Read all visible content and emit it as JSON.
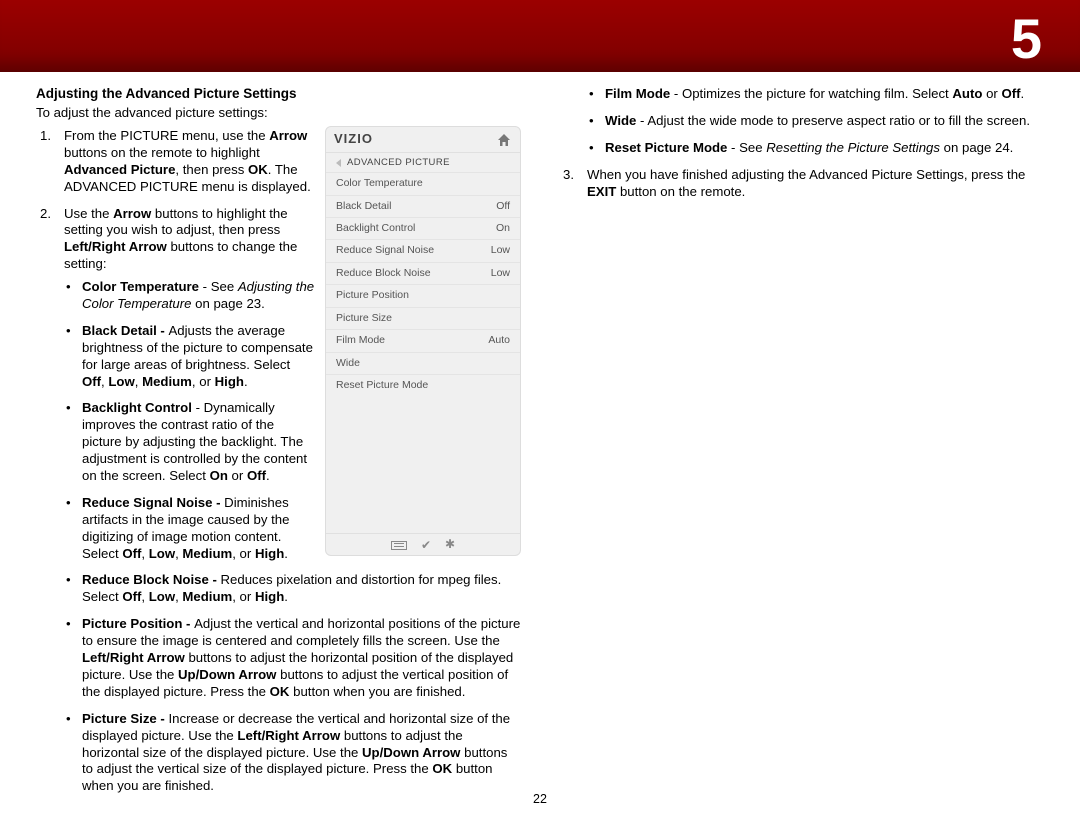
{
  "chapter": "5",
  "page_number": "22",
  "heading": "Adjusting the Advanced Picture Settings",
  "intro": "To adjust the advanced picture settings:",
  "step1": {
    "a": "From the PICTURE menu, use the ",
    "b": "Arrow",
    "c": " buttons on the remote to highlight ",
    "d": "Advanced Picture",
    "e": ", then press ",
    "f": "OK",
    "g": ". The ADVANCED PICTURE menu is displayed."
  },
  "step2": {
    "a": "Use the ",
    "b": "Arrow",
    "c": " buttons to highlight the setting you wish to adjust, then press ",
    "d": "Left/Right Arrow",
    "e": " buttons to change the setting:"
  },
  "bullets": {
    "ct": {
      "t": "Color Temperature",
      "a": " - See ",
      "it": "Adjusting the Color Temperature",
      "b": " on page 23."
    },
    "bd": {
      "t": "Black Detail - ",
      "a": "Adjusts the average brightness of the picture to compensate for large areas of brightness. Select ",
      "o1": "Off",
      "c1": ", ",
      "o2": "Low",
      "c2": ", ",
      "o3": "Medium",
      "c3": ", or ",
      "o4": "High",
      "p": "."
    },
    "bc": {
      "t": "Backlight Control",
      "a": " - Dynamically improves the contrast ratio of the picture by adjusting the backlight. The adjustment is controlled by the content on the screen. Select ",
      "o1": "On",
      "c1": " or ",
      "o2": "Off",
      "p": "."
    },
    "rsn": {
      "t": "Reduce Signal Noise - ",
      "a": "Diminishes artifacts in the image caused by the digitizing of image motion content. Select ",
      "o1": "Off",
      "c1": ", ",
      "o2": "Low",
      "c2": ", ",
      "o3": "Medium",
      "c3": ", or ",
      "o4": "High",
      "p": "."
    },
    "rbn": {
      "t": "Reduce Block Noise - ",
      "a": "Reduces pixelation and distortion for mpeg files. Select ",
      "o1": "Off",
      "c1": ", ",
      "o2": "Low",
      "c2": ", ",
      "o3": "Medium",
      "c3": ", or ",
      "o4": "High",
      "p": "."
    },
    "pp": {
      "t": "Picture Position - ",
      "a": "Adjust the vertical and horizontal positions of the picture to ensure the image is centered and completely fills the screen. Use the ",
      "b": "Left/Right Arrow",
      "c": " buttons to adjust the horizontal position of the displayed picture. Use the ",
      "d": "Up/Down Arrow",
      "e": " buttons to adjust the vertical position of the displayed picture. Press the ",
      "f": "OK",
      "g": " button when you are finished."
    },
    "ps": {
      "t": "Picture Size - ",
      "a": "Increase or decrease the vertical and horizontal size of the displayed picture. Use the ",
      "b": "Left/Right Arrow",
      "c": " buttons to adjust the horizontal size of the displayed picture. Use the ",
      "d": "Up/Down Arrow",
      "e": " buttons to adjust the vertical size of the displayed picture. Press the ",
      "f": "OK",
      "g": " button when you are finished."
    },
    "fm": {
      "t": "Film Mode",
      "a": " - Optimizes the picture for watching film. Select ",
      "o1": "Auto",
      "c1": " or ",
      "o2": "Off",
      "p": "."
    },
    "wd": {
      "t": "Wide",
      "a": " - Adjust the wide mode to preserve aspect ratio or to fill the screen."
    },
    "rpm": {
      "t": "Reset Picture Mode",
      "a": " - See ",
      "it": "Resetting the Picture Settings",
      "b": " on page 24."
    }
  },
  "step3": {
    "a": "When you have finished adjusting the Advanced Picture Settings, press the ",
    "b": "EXIT",
    "c": " button on the remote."
  },
  "menu": {
    "logo": "VIZIO",
    "breadcrumb": "ADVANCED PICTURE",
    "rows": [
      {
        "label": "Color Temperature",
        "value": ""
      },
      {
        "label": "Black Detail",
        "value": "Off"
      },
      {
        "label": "Backlight Control",
        "value": "On"
      },
      {
        "label": "Reduce Signal Noise",
        "value": "Low"
      },
      {
        "label": "Reduce Block Noise",
        "value": "Low"
      },
      {
        "label": "Picture Position",
        "value": ""
      },
      {
        "label": "Picture Size",
        "value": ""
      },
      {
        "label": "Film Mode",
        "value": "Auto"
      },
      {
        "label": "Wide",
        "value": ""
      },
      {
        "label": "Reset Picture Mode",
        "value": ""
      }
    ]
  }
}
